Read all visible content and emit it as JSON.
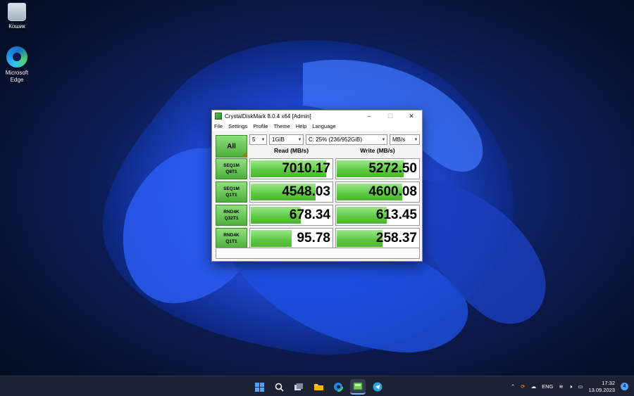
{
  "desktop": {
    "icons": [
      {
        "label": "Кошик"
      },
      {
        "label": "Microsoft Edge"
      }
    ]
  },
  "window": {
    "title": "CrystalDiskMark 8.0.4 x64 [Admin]",
    "menu": [
      "File",
      "Settings",
      "Profile",
      "Theme",
      "Help",
      "Language"
    ],
    "all_label": "All",
    "count": "5",
    "size": "1GiB",
    "drive": "C: 25% (236/952GiB)",
    "unit": "MB/s",
    "read_header": "Read (MB/s)",
    "write_header": "Write (MB/s)",
    "rows": [
      {
        "line1": "SEQ1M",
        "line2": "Q8T1",
        "read": "7010.17",
        "write": "5272.50",
        "read_fill": 0.93,
        "write_fill": 0.82
      },
      {
        "line1": "SEQ1M",
        "line2": "Q1T1",
        "read": "4548.03",
        "write": "4600.08",
        "read_fill": 0.8,
        "write_fill": 0.8
      },
      {
        "line1": "RND4K",
        "line2": "Q32T1",
        "read": "678.34",
        "write": "613.45",
        "read_fill": 0.62,
        "write_fill": 0.61
      },
      {
        "line1": "RND4K",
        "line2": "Q1T1",
        "read": "95.78",
        "write": "258.37",
        "read_fill": 0.5,
        "write_fill": 0.56
      }
    ],
    "accent": "#4caf3a"
  },
  "taskbar": {
    "icons": [
      "windows-start-icon",
      "search-icon",
      "task-view-icon",
      "file-explorer-icon",
      "edge-icon",
      "crystaldiskmark-icon",
      "telegram-icon"
    ],
    "tray": {
      "language": "ENG",
      "time": "17:32",
      "date": "13.09.2023",
      "notifications": "4"
    }
  }
}
